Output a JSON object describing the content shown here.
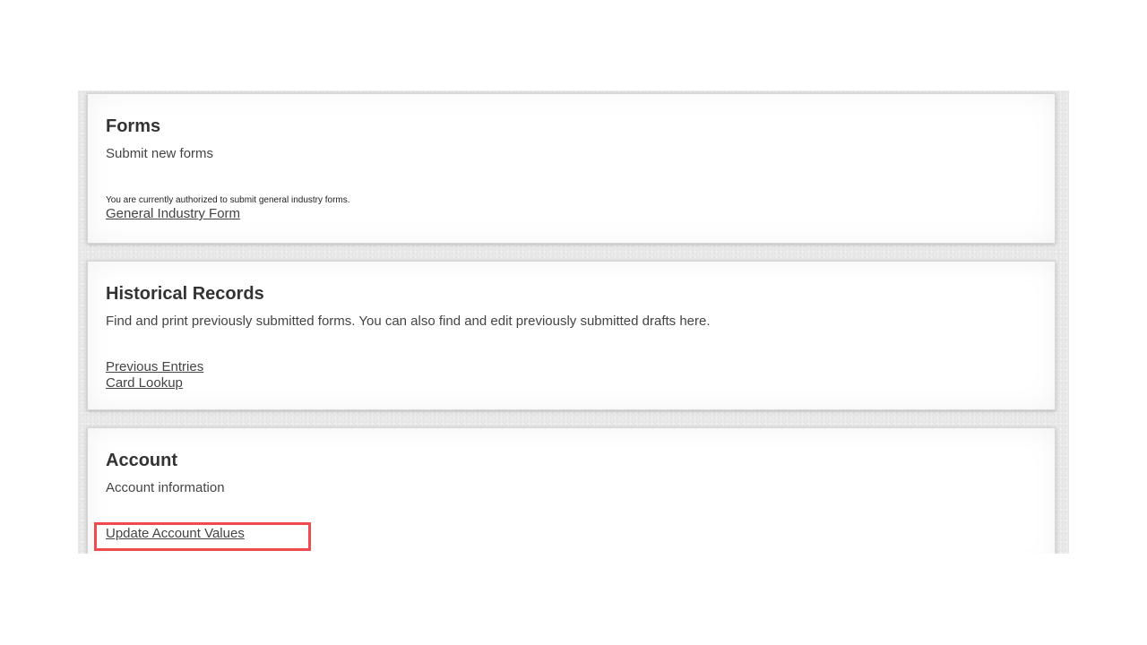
{
  "forms": {
    "title": "Forms",
    "description": "Submit new forms",
    "note": "You are currently authorized to submit general industry forms.",
    "links": [
      "General Industry Form"
    ]
  },
  "history": {
    "title": "Historical Records",
    "description": "Find and print previously submitted forms. You can also find and edit previously submitted drafts here.",
    "links": [
      "Previous Entries",
      "Card Lookup"
    ]
  },
  "account": {
    "title": "Account",
    "description": "Account information",
    "links": [
      "Update Account Values"
    ]
  },
  "colors": {
    "highlight": "#ef4b4f",
    "background": "#e9e9e9"
  }
}
